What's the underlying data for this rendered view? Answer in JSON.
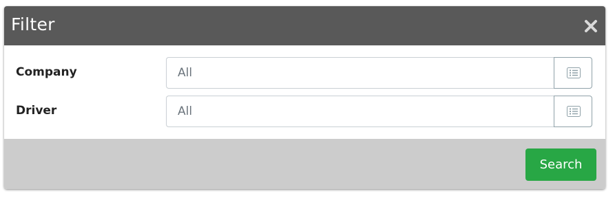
{
  "dialog": {
    "title": "Filter",
    "close_icon": "close-icon"
  },
  "fields": [
    {
      "label": "Company",
      "value": "All",
      "button_icon": "list-icon"
    },
    {
      "label": "Driver",
      "value": "All",
      "button_icon": "list-icon"
    }
  ],
  "footer": {
    "search_label": "Search"
  },
  "colors": {
    "header_bg": "#595959",
    "footer_bg": "#cccccc",
    "search_button_bg": "#28a745",
    "list_icon": "#8fa1a8"
  }
}
